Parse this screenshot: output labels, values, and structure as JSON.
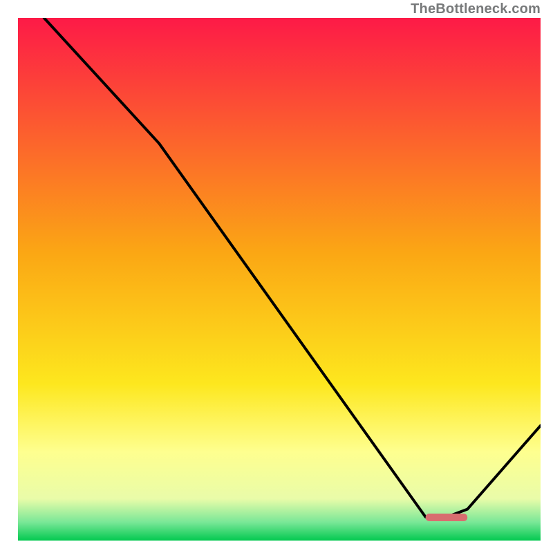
{
  "attribution": "TheBottleneck.com",
  "chart_data": {
    "type": "line",
    "title": "",
    "xlabel": "",
    "ylabel": "",
    "xlim": [
      0,
      100
    ],
    "ylim": [
      0,
      100
    ],
    "curve": {
      "name": "bottleneck-curve",
      "x": [
        5,
        27,
        78,
        82,
        86,
        100
      ],
      "values": [
        100,
        76,
        4.5,
        4.5,
        6,
        22
      ]
    },
    "optimal_marker": {
      "name": "optimal-range",
      "x_start": 78,
      "x_end": 86,
      "y": 4.5,
      "color": "#d86d6f"
    },
    "background_gradient": {
      "stops": [
        {
          "offset": 0.0,
          "color": "#fd1a47"
        },
        {
          "offset": 0.45,
          "color": "#fba714"
        },
        {
          "offset": 0.7,
          "color": "#fde71e"
        },
        {
          "offset": 0.83,
          "color": "#feff8f"
        },
        {
          "offset": 0.92,
          "color": "#e9fca9"
        },
        {
          "offset": 0.965,
          "color": "#79e797"
        },
        {
          "offset": 1.0,
          "color": "#03c950"
        }
      ]
    }
  }
}
